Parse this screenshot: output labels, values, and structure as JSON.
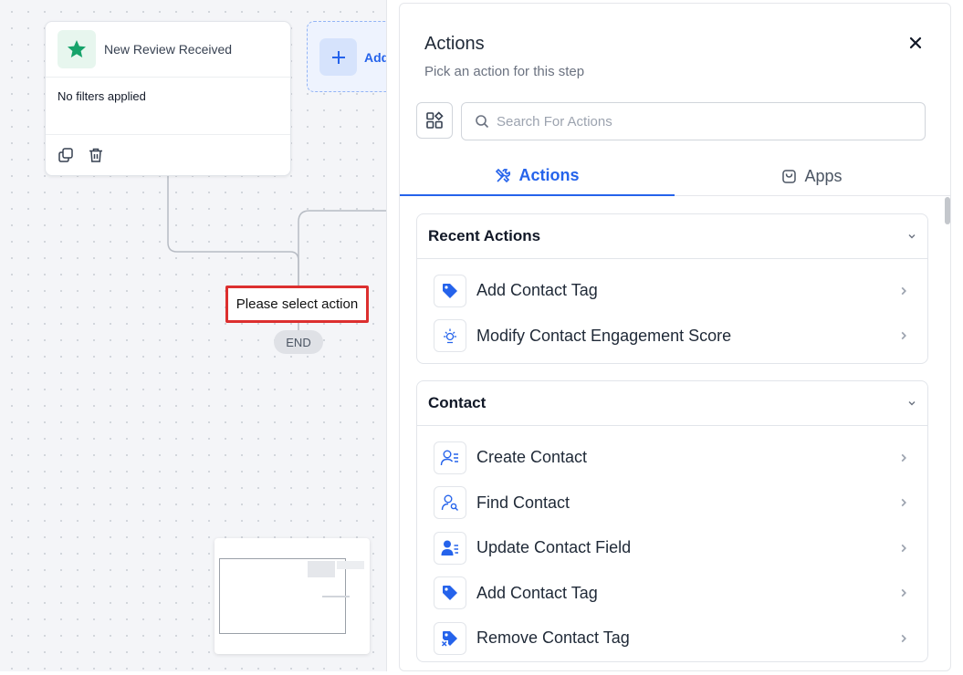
{
  "canvas": {
    "trigger": {
      "title": "New Review Received",
      "filters": "No filters applied",
      "icon": "star-icon",
      "accent": "#16a36a"
    },
    "add_node": {
      "label": "Add"
    },
    "pending_action": "Please select action",
    "end_label": "END"
  },
  "panel": {
    "title": "Actions",
    "subtitle": "Pick an action for this step",
    "search_placeholder": "Search For Actions",
    "tabs": [
      {
        "label": "Actions",
        "icon": "tools-icon",
        "active": true
      },
      {
        "label": "Apps",
        "icon": "bag-icon",
        "active": false
      }
    ],
    "sections": [
      {
        "title": "Recent Actions",
        "items": [
          {
            "label": "Add Contact Tag",
            "icon": "tag-icon"
          },
          {
            "label": "Modify Contact Engagement Score",
            "icon": "sparkle-icon"
          }
        ]
      },
      {
        "title": "Contact",
        "items": [
          {
            "label": "Create Contact",
            "icon": "user-list-icon"
          },
          {
            "label": "Find Contact",
            "icon": "user-search-icon"
          },
          {
            "label": "Update Contact Field",
            "icon": "user-edit-icon"
          },
          {
            "label": "Add Contact Tag",
            "icon": "tag-icon"
          },
          {
            "label": "Remove Contact Tag",
            "icon": "tag-remove-icon"
          }
        ]
      }
    ],
    "accent": "#2563eb"
  }
}
